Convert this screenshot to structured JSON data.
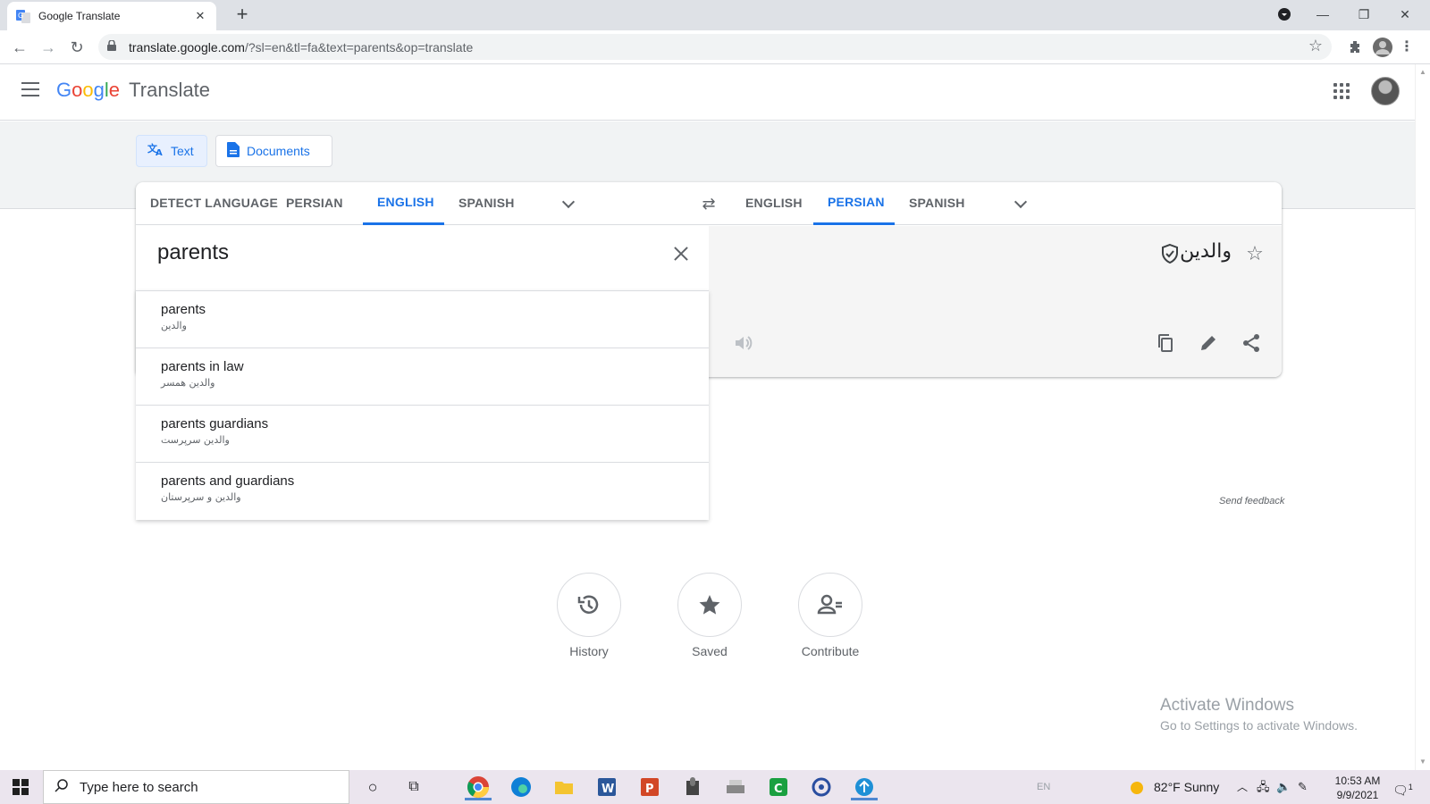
{
  "browser": {
    "tab_title": "Google Translate",
    "url_host": "translate.google.com",
    "url_path": "/?sl=en&tl=fa&text=parents&op=translate"
  },
  "header": {
    "logo_parts": [
      "G",
      "o",
      "o",
      "g",
      "l",
      "e"
    ],
    "product": "Translate"
  },
  "modes": {
    "text_label": "Text",
    "documents_label": "Documents"
  },
  "source_langs": [
    "DETECT LANGUAGE",
    "PERSIAN",
    "ENGLISH",
    "SPANISH"
  ],
  "target_langs": [
    "ENGLISH",
    "PERSIAN",
    "SPANISH"
  ],
  "source_text": "parents",
  "translation": "والدین",
  "suggestions": [
    {
      "en": "parents",
      "fa": "والدین"
    },
    {
      "en": "parents in law",
      "fa": "والدین همسر"
    },
    {
      "en": "parents guardians",
      "fa": "والدین سرپرست"
    },
    {
      "en": "parents and guardians",
      "fa": "والدین و سرپرستان"
    }
  ],
  "feedback": "Send feedback",
  "bottom_actions": {
    "history": "History",
    "saved": "Saved",
    "contribute": "Contribute"
  },
  "watermark": {
    "line1": "Activate Windows",
    "line2": "Go to Settings to activate Windows."
  },
  "taskbar": {
    "search_placeholder": "Type here to search",
    "lang": "EN",
    "weather": "82°F  Sunny",
    "time": "10:53 AM",
    "date": "9/9/2021",
    "notif_count": "1"
  },
  "colors": {
    "accent": "#1a73e8",
    "active_mode_bg": "#e8f0fe",
    "band": "#f1f3f4"
  }
}
